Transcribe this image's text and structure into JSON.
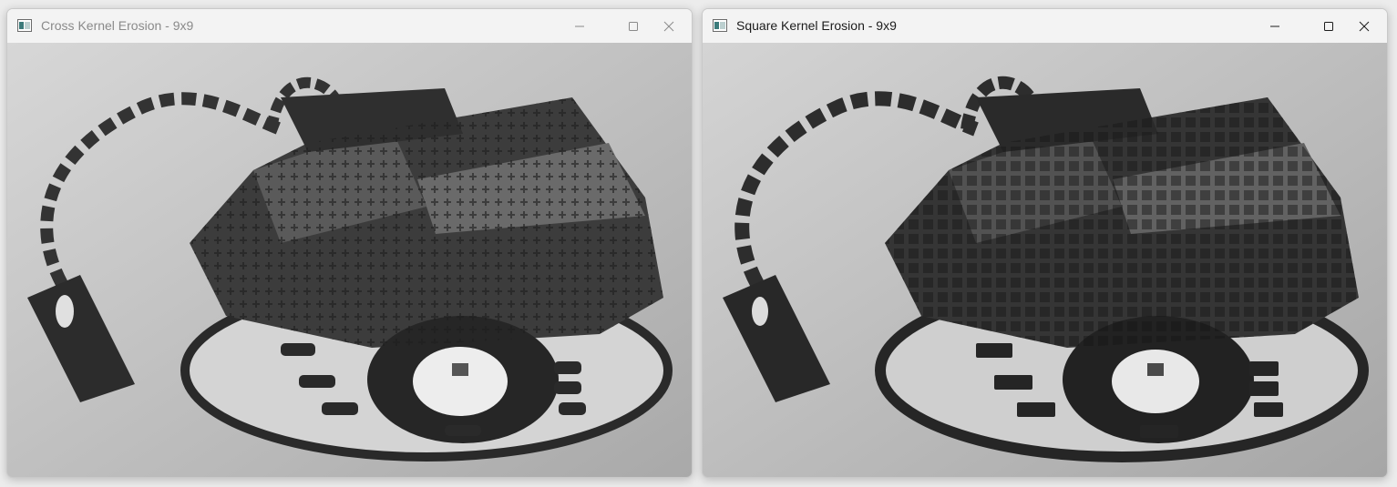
{
  "windows": [
    {
      "title": "Cross Kernel Erosion - 9x9",
      "icon": "opencv-window-icon",
      "state": "inactive",
      "kernel": "cross"
    },
    {
      "title": "Square Kernel Erosion - 9x9",
      "icon": "opencv-window-icon",
      "state": "active",
      "kernel": "square"
    }
  ],
  "controls": {
    "minimize": "minimize-icon",
    "maximize": "maximize-icon",
    "close": "close-icon"
  },
  "image": {
    "subject": "eroded grayscale photo of a wheeled robot kit",
    "palette": {
      "background": "#b9b9b9",
      "body_dark": "#2e2e2e",
      "body_mid": "#4a4a4a",
      "wheel_hub": "#e6e6e6"
    }
  }
}
